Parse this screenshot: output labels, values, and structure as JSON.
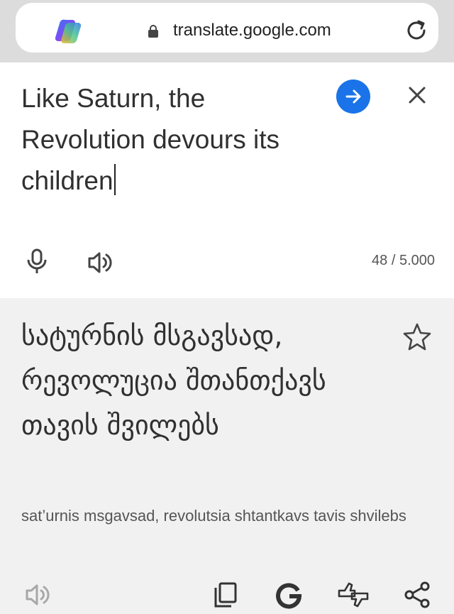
{
  "browser": {
    "url": "translate.google.com"
  },
  "source": {
    "text": "Like Saturn, the Revolution devours its children",
    "char_count": "48 / 5.000"
  },
  "translation": {
    "text": "სატურნის მსგავსად, რევოლუცია შთანთქავს თავის შვილებს",
    "transliteration": "sat’urnis msgavsad, revolutsia shtantkavs tavis shvilebs"
  },
  "colors": {
    "accent": "#1a73e8",
    "icon": "#444444",
    "icon_disabled": "#9e9e9e"
  }
}
